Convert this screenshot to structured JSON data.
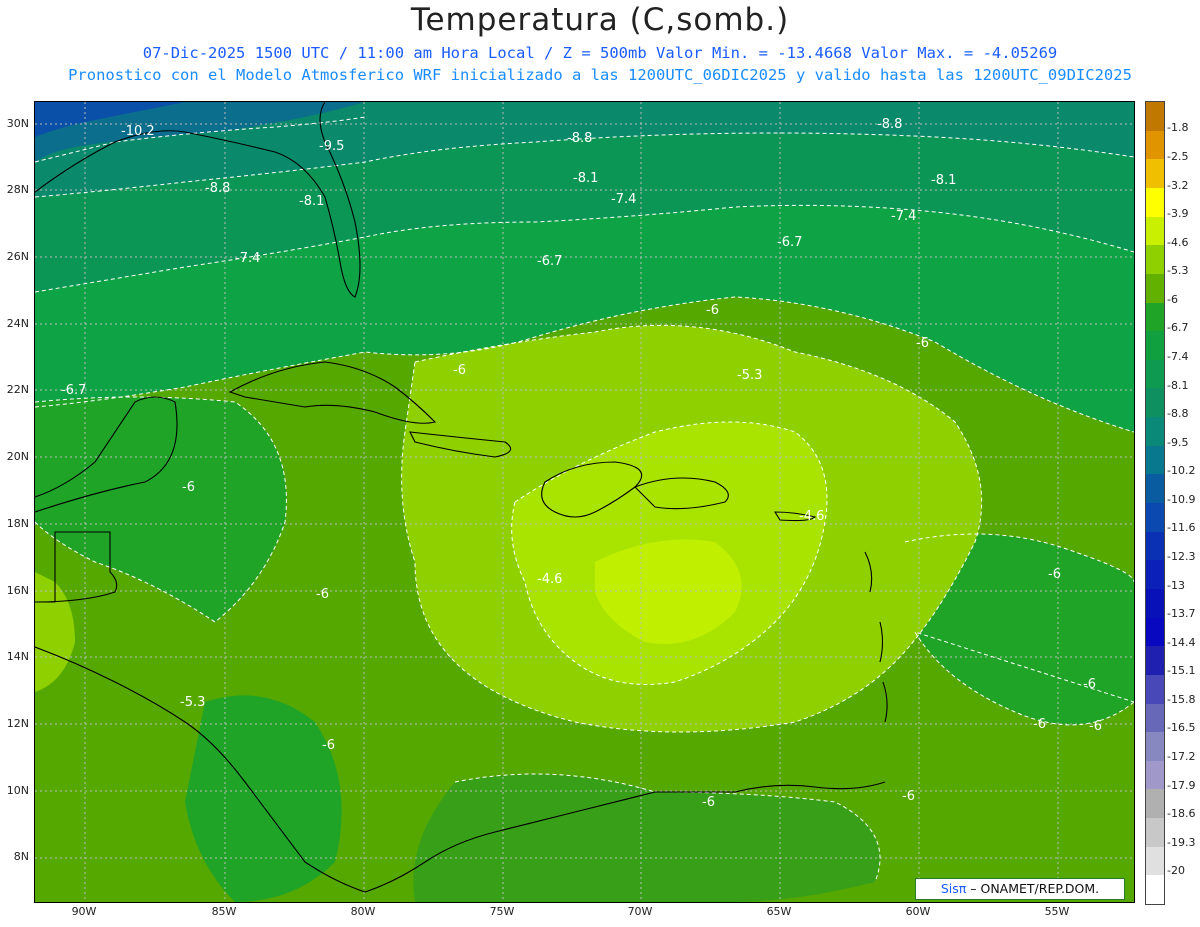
{
  "title": "Temperatura (C,somb.)",
  "subtitle_line1": "07-Dic-2025  1500 UTC / 11:00 am Hora Local / Z = 500mb  Valor Min. = -13.4668  Valor Max. = -4.05269",
  "subtitle_line2": "Pronostico con el Modelo Atmosferico WRF inicializado a las 1200UTC_06DIC2025 y valido hasta las  1200UTC_09DIC2025",
  "credit": {
    "brand": "Sisπ",
    "text": " – ONAMET/REP.DOM."
  },
  "map": {
    "lat_labels": [
      "30N",
      "28N",
      "26N",
      "24N",
      "22N",
      "20N",
      "18N",
      "16N",
      "14N",
      "12N",
      "10N",
      "8N"
    ],
    "lon_labels": [
      "90W",
      "85W",
      "80W",
      "75W",
      "70W",
      "65W",
      "60W",
      "55W"
    ],
    "contour_labels": [
      "-10.2",
      "-9.5",
      "-8.8",
      "-8.8",
      "-8.8",
      "-8.1",
      "-8.1",
      "-8.1",
      "-7.4",
      "-7.4",
      "-7.4",
      "-6.7",
      "-6.7",
      "-6.7",
      "-6",
      "-6",
      "-6",
      "-5.3",
      "-6",
      "-4.6",
      "-4.6",
      "-6",
      "-6",
      "-6",
      "-5.3",
      "-6",
      "-6",
      "-6",
      "-6",
      "-6"
    ]
  },
  "colorbar": {
    "labels": [
      "-1.8",
      "-2.5",
      "-3.2",
      "-3.9",
      "-4.6",
      "-5.3",
      "-6",
      "-6.7",
      "-7.4",
      "-8.1",
      "-8.8",
      "-9.5",
      "-10.2",
      "-10.9",
      "-11.6",
      "-12.3",
      "-13",
      "-13.7",
      "-14.4",
      "-15.1",
      "-15.8",
      "-16.5",
      "-17.2",
      "-17.9",
      "-18.6",
      "-19.3",
      "-20"
    ],
    "colors": [
      "#c07800",
      "#e09400",
      "#f0c000",
      "#ffff00",
      "#c8f000",
      "#8ed000",
      "#62b000",
      "#1fa428",
      "#10a040",
      "#0e9a50",
      "#0e9060",
      "#0a8878",
      "#08788e",
      "#0a5ca0",
      "#0b48b0",
      "#0a30b4",
      "#0a20b8",
      "#0810b8",
      "#0808c0",
      "#2020b0",
      "#4848b8",
      "#6868b8",
      "#8888c0",
      "#a098c8",
      "#b0b0b0",
      "#c8c8c8",
      "#e0e0e0",
      "#ffffff"
    ]
  }
}
